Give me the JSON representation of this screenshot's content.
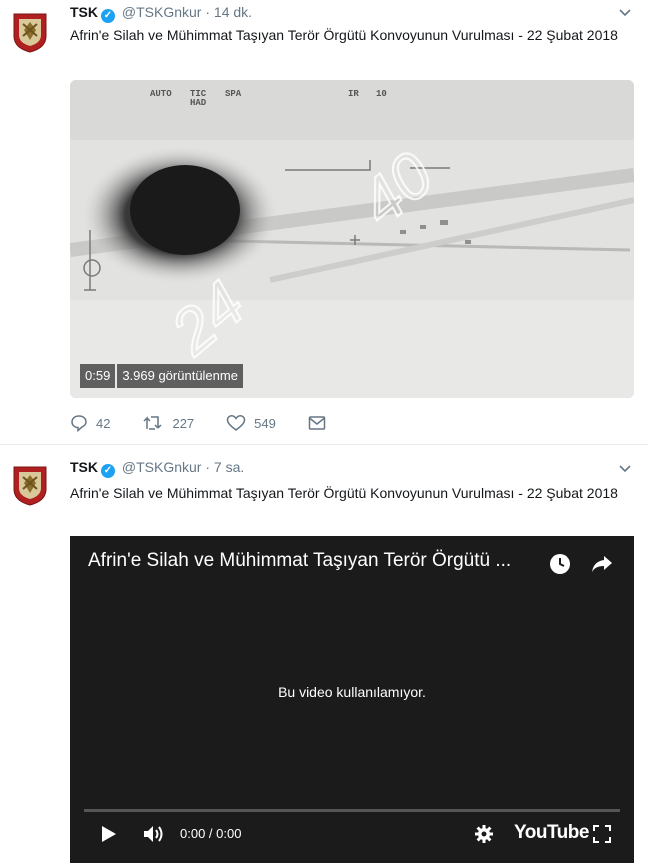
{
  "tweets": [
    {
      "name": "TSK",
      "handle": "@TSKGnkur",
      "time": "· 14 dk.",
      "text": "Afrin'e Silah ve Mühimmat Taşıyan Terör Örgütü Konvoyunun Vurulması - 22 Şubat 2018",
      "video": {
        "duration": "0:59",
        "views": "3.969 görüntülenme",
        "overlay_numbers": [
          "24",
          "40"
        ]
      },
      "actions": {
        "replies": "42",
        "retweets": "227",
        "likes": "549"
      }
    },
    {
      "name": "TSK",
      "handle": "@TSKGnkur",
      "time": "· 7 sa.",
      "text": "Afrin'e Silah ve Mühimmat Taşıyan Terör Örgütü Konvoyunun Vurulması - 22 Şubat 2018",
      "embed": {
        "title": "Afrin'e Silah ve Mühimmat Taşıyan Terör Örgütü ...",
        "message": "Bu video kullanılamıyor.",
        "time": "0:00 / 0:00",
        "brand": "YouTube"
      }
    }
  ],
  "colors": {
    "verified": "#1da1f2",
    "muted": "#657786",
    "player_bg": "#1b1b1b"
  }
}
